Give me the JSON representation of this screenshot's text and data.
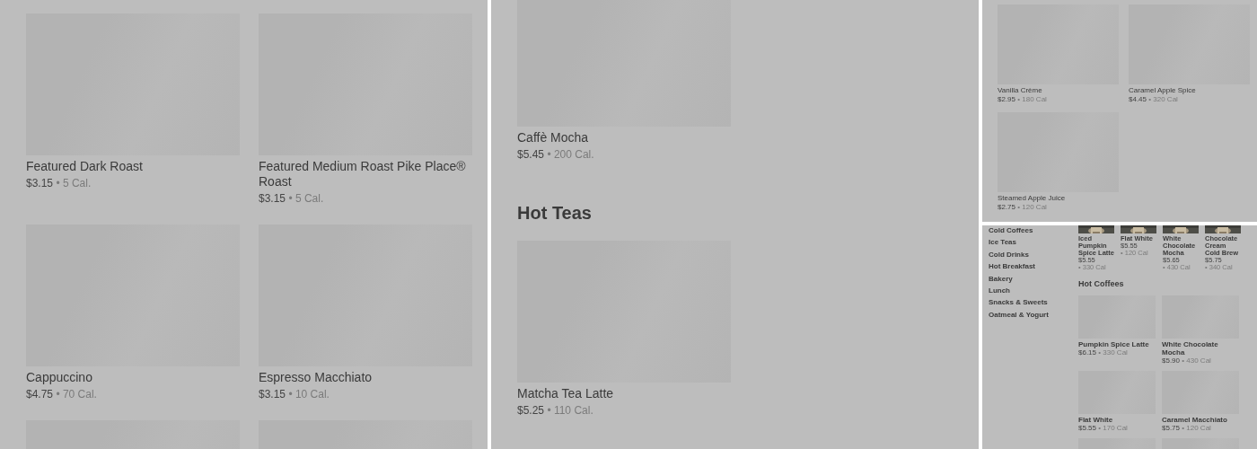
{
  "panels": [
    {
      "kind": "large",
      "sections": [
        {
          "items": [
            {
              "name": "Featured Dark Roast",
              "price": "$3.15",
              "calories": "• 5 Cal.",
              "kind": "placeholder"
            },
            {
              "name": "Featured Medium Roast Pike Place® Roast",
              "price": "$3.15",
              "calories": "• 5 Cal.",
              "kind": "placeholder"
            },
            {
              "name": "Cappuccino",
              "price": "$4.75",
              "calories": "• 70 Cal.",
              "kind": "placeholder"
            },
            {
              "name": "Espresso Macchiato",
              "price": "$3.15",
              "calories": "• 10 Cal.",
              "kind": "placeholder"
            },
            {
              "kind": "placeholder"
            },
            {
              "kind": "placeholder"
            }
          ]
        }
      ]
    },
    {
      "kind": "large",
      "sections": [
        {
          "items": [
            {
              "name": "Caffè Mocha",
              "price": "$5.45",
              "calories": "• 200 Cal.",
              "kind": "placeholder"
            }
          ]
        },
        {
          "heading": "Hot Teas",
          "items": [
            {
              "name": "Matcha Tea Latte",
              "price": "$5.25",
              "calories": "• 110 Cal.",
              "kind": "placeholder"
            }
          ]
        }
      ]
    },
    {
      "kind": "small",
      "sections": [
        {
          "items": [
            {
              "name": "Vanilla Crème",
              "price": "$2.95",
              "calories": "• 180 Cal",
              "kind": "placeholder"
            },
            {
              "name": "Caramel Apple Spice",
              "price": "$4.45",
              "calories": "• 320 Cal",
              "kind": "placeholder"
            },
            {
              "name": "Steamed Apple Juice",
              "price": "$2.75",
              "calories": "• 120 Cal",
              "kind": "placeholder"
            }
          ]
        }
      ]
    },
    {
      "kind": "sidebar",
      "sidebar": [
        {
          "label": "Cold Coffees"
        },
        {
          "label": "Ice Teas"
        },
        {
          "label": "Cold Drinks"
        },
        {
          "label": "Hot Breakfast"
        },
        {
          "label": "Bakery"
        },
        {
          "label": "Lunch"
        },
        {
          "label": "Snacks & Sweets"
        },
        {
          "label": "Oatmeal & Yogurt"
        }
      ],
      "sections": [
        {
          "kind": "strip",
          "items": [
            {
              "name": "Iced Pumpkin Spice Latte",
              "price": "$5.55",
              "calories": "• 330 Cal"
            },
            {
              "name": "Flat White",
              "price": "$5.55",
              "calories": "• 120 Cal"
            },
            {
              "name": "White Chocolate Mocha",
              "price": "$5.65",
              "calories": "• 430 Cal"
            },
            {
              "name": "Chocolate Cream Cold Brew",
              "price": "$5.75",
              "calories": "• 340 Cal"
            }
          ]
        },
        {
          "heading": "Hot Coffees",
          "items": [
            {
              "name": "Pumpkin Spice Latte",
              "price": "$6.15",
              "calories": "• 330 Cal",
              "kind": "placeholder"
            },
            {
              "name": "White Chocolate Mocha",
              "price": "$5.90",
              "calories": "• 430 Cal",
              "kind": "placeholder"
            },
            {
              "name": "Flat White",
              "price": "$5.55",
              "calories": "• 170 Cal",
              "kind": "placeholder"
            },
            {
              "name": "Caramel Macchiato",
              "price": "$5.75",
              "calories": "• 120 Cal",
              "kind": "placeholder"
            },
            {
              "kind": "placeholder"
            },
            {
              "kind": "placeholder"
            }
          ]
        }
      ]
    }
  ]
}
